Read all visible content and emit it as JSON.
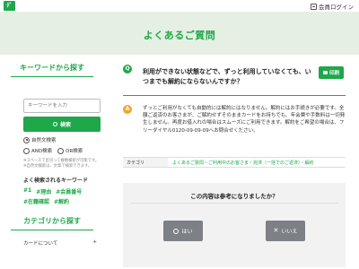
{
  "header": {
    "logo_text": "ﾃﾞ",
    "member_login": "会員ログイン"
  },
  "banner": {
    "title": "よくあるご質問"
  },
  "sidebar": {
    "keyword_heading": "キーワードから探す",
    "search_placeholder": "キーワードを入力",
    "search_button": "検索",
    "radio_natural": "自然文検索",
    "radio_and": "AND検索",
    "radio_or": "OR検索",
    "hint": "※スペースで区切って複数検索が可能です。※自然文検索は、文章で検索できます。",
    "popular_heading": "よく検索されるキーワード",
    "tags": [
      "#1",
      "#理由",
      "#会員番号",
      "#在籍確認",
      "#解約"
    ],
    "category_heading": "カテゴリから探す",
    "category_item": "カードについて",
    "category_toggle": "+"
  },
  "question": {
    "icon": "Q",
    "text": "利用ができない状態などで、ずっと利用していなくても、いつまでも解約にならないんですか？",
    "print_button": "印刷"
  },
  "answer": {
    "icon": "A",
    "text": "ずっとご利用がなくても自動的には解約にはなりません。解約にはお手続きが必要です。全額ご返済のお客さまが、ご解約せずそのままカードをお持ちでも、年会費や手数料は一切発生しません。再度お借入れの場合はスムーズにご利用できます。解約をご希望の場合は、フリーダイヤル0120-09-09-09へお問合せください。"
  },
  "category": {
    "label": "カテゴリ",
    "value": "よくあるご質問・ご利用中のお客さま・完済（一括でのご返済）・解約"
  },
  "feedback": {
    "title": "この内容は参考になりましたか？",
    "yes": "はい",
    "no": "いいえ"
  },
  "colors": {
    "accent": "#1ea84a",
    "answer_icon": "#f4a52c",
    "banner_bg": "#e6efe3",
    "button_gray": "#7d8084"
  }
}
